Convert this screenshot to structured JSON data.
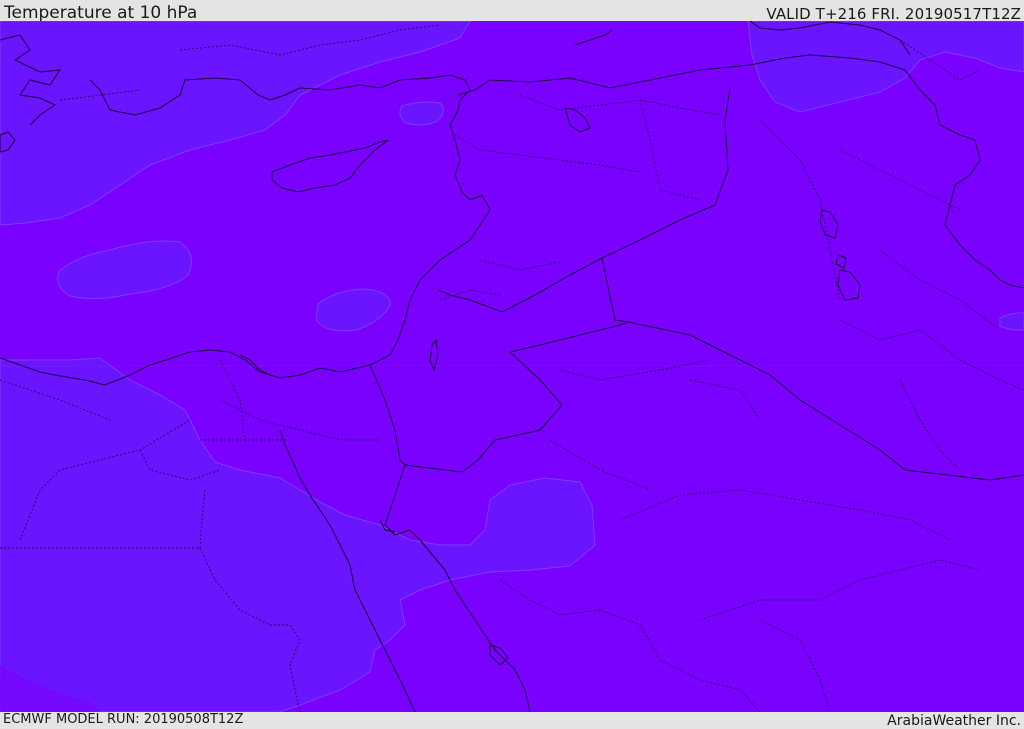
{
  "header": {
    "title": "Temperature at 10 hPa",
    "valid": "VALID T+216 FRI. 20190517T12Z"
  },
  "footer": {
    "model_run": "ECMWF MODEL RUN: 20190508T12Z",
    "credit": "ArabiaWeather Inc."
  },
  "map": {
    "region": "Eastern Mediterranean and Middle East",
    "field": "temperature at 10 hPa",
    "colors": {
      "main_fill": "#7a00ff",
      "cooler_fill": "#6a14ff",
      "coastline": "#1a0040",
      "border": "#2a0060"
    }
  }
}
